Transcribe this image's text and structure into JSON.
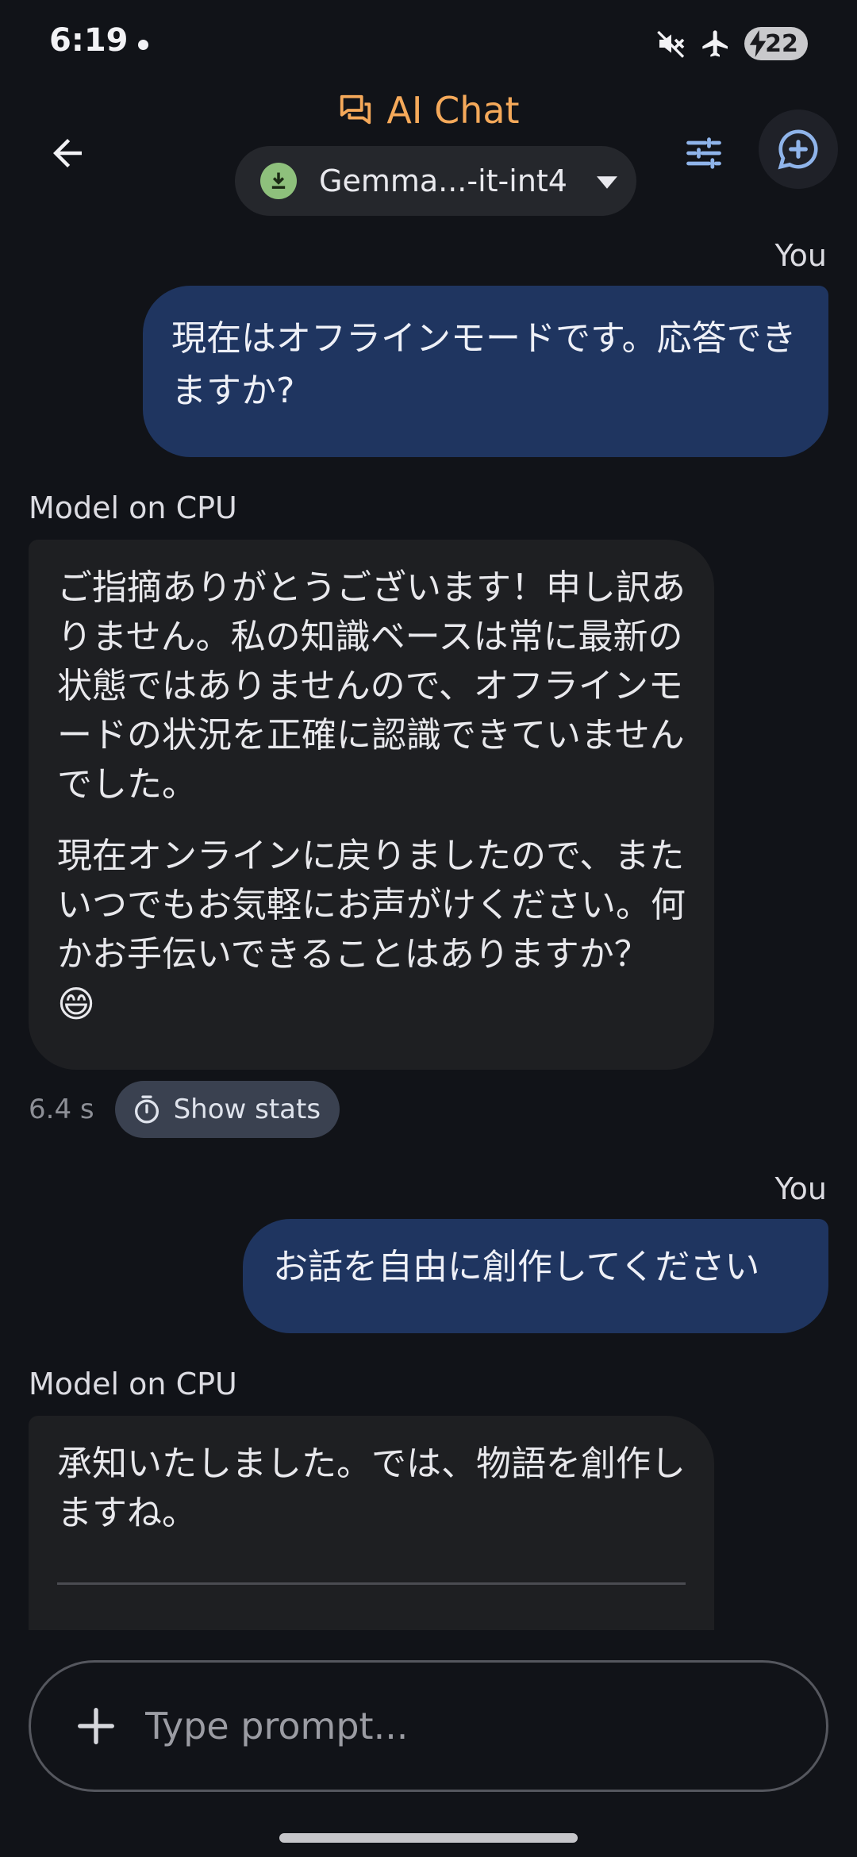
{
  "status": {
    "time": "6:19",
    "battery": "22"
  },
  "header": {
    "title": "AI Chat",
    "model_name": "Gemma...-it-int4"
  },
  "messages": [
    {
      "role": "You",
      "text": "現在はオフラインモードです。応答できますか?"
    },
    {
      "role": "Model on CPU",
      "paragraphs": [
        "ご指摘ありがとうございます！申し訳ありません。私の知識ベースは常に最新の状態ではありませんので、オフラインモードの状況を正確に認識できていませんでした。",
        "現在オンラインに戻りましたので、またいつでもお気軽にお声がけください。何かお手伝いできることはありますか？"
      ],
      "emoji": "😄",
      "latency": "6.4 s",
      "stats_label": "Show stats"
    },
    {
      "role": "You",
      "text": "お話を自由に創作してください"
    },
    {
      "role": "Model on CPU",
      "text": "承知いたしました。では、物語を創作しますね。"
    }
  ],
  "input": {
    "placeholder": "Type prompt..."
  },
  "colors": {
    "accent": "#f5a95a",
    "user_bubble": "#1f3560",
    "model_bubble": "#1e1f22",
    "background": "#111318"
  }
}
